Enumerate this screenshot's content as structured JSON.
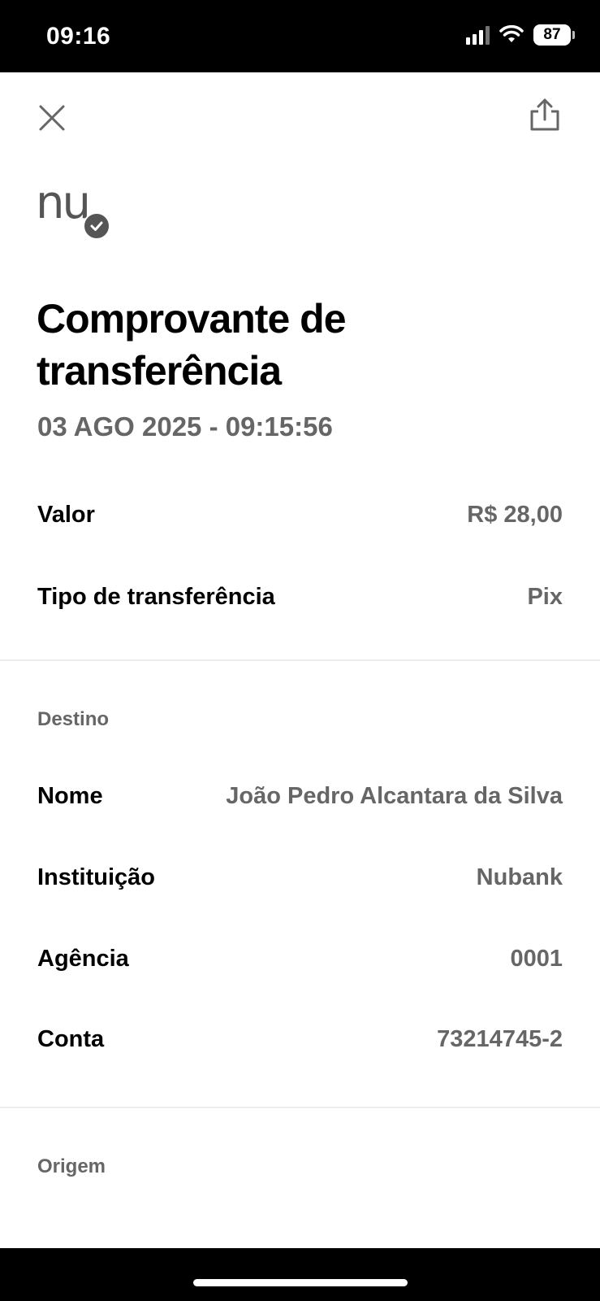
{
  "status_bar": {
    "time": "09:16",
    "battery": "87"
  },
  "header": {
    "close_icon": "close-icon",
    "share_icon": "share-icon"
  },
  "logo": {
    "text": "nu",
    "badge_icon": "check-icon"
  },
  "receipt": {
    "title": "Comprovante de transferência",
    "datetime": "03 AGO 2025 - 09:15:56",
    "summary": [
      {
        "label": "Valor",
        "value": "R$ 28,00"
      },
      {
        "label": "Tipo de transferência",
        "value": "Pix"
      }
    ],
    "destino": {
      "title": "Destino",
      "rows": [
        {
          "label": "Nome",
          "value": "João Pedro Alcantara da Silva"
        },
        {
          "label": "Instituição",
          "value": "Nubank"
        },
        {
          "label": "Agência",
          "value": "0001"
        },
        {
          "label": "Conta",
          "value": "73214745-2"
        }
      ]
    },
    "origem": {
      "title": "Origem"
    }
  },
  "colors": {
    "text_primary": "#000000",
    "text_secondary": "#666666",
    "divider": "#ececec",
    "background": "#ffffff"
  }
}
